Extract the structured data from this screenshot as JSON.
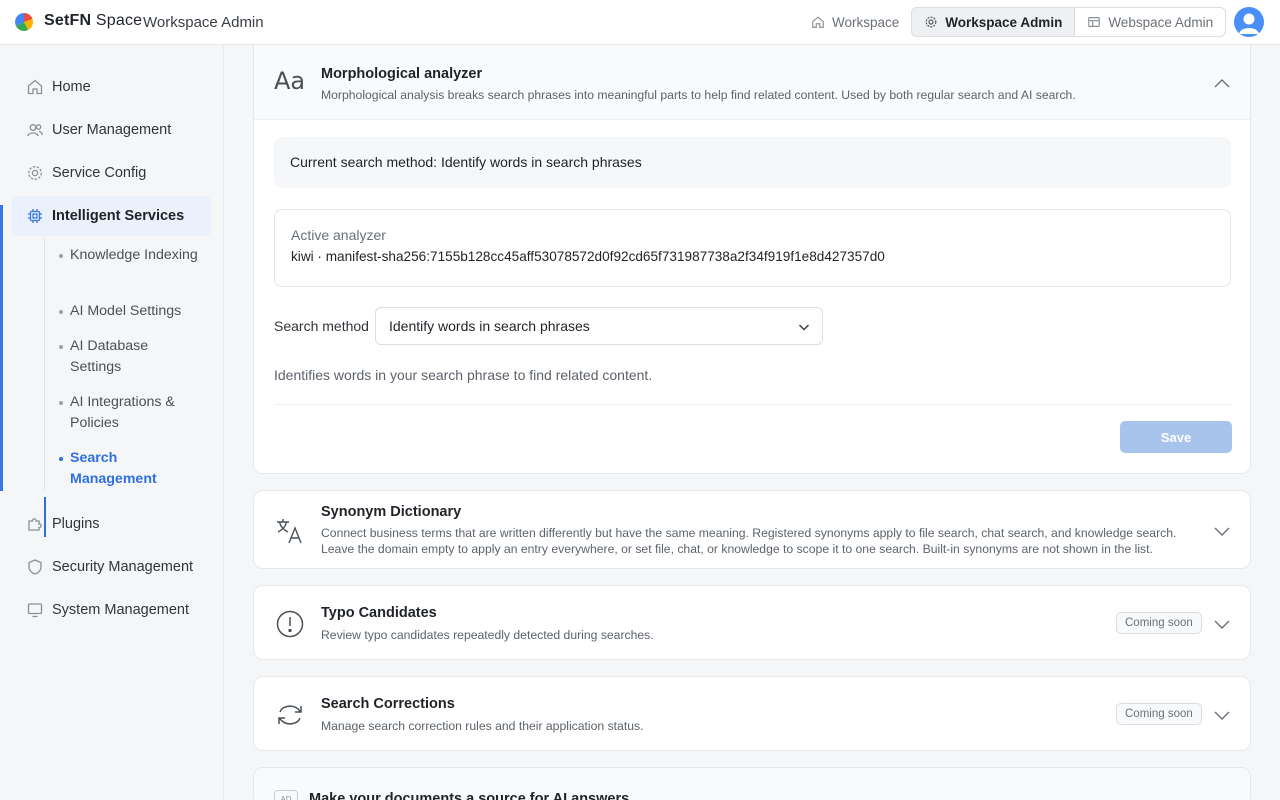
{
  "header": {
    "brand_bold": "SetFN",
    "brand_light": "Space",
    "subtitle": "Workspace Admin",
    "tabs": [
      {
        "label": "Workspace",
        "icon": "home-icon"
      },
      {
        "label": "Workspace Admin",
        "icon": "gear-icon"
      },
      {
        "label": "Webspace Admin",
        "icon": "layout-icon"
      }
    ]
  },
  "sidebar": {
    "items": [
      {
        "label": "Home",
        "icon": "home-icon"
      },
      {
        "label": "User Management",
        "icon": "users-icon"
      },
      {
        "label": "Service Config",
        "icon": "gear-icon"
      },
      {
        "label": "Intelligent Services",
        "icon": "chip-icon"
      },
      {
        "label": "Plugins",
        "icon": "puzzle-icon"
      },
      {
        "label": "Security Management",
        "icon": "shield-icon"
      },
      {
        "label": "System Management",
        "icon": "monitor-icon"
      }
    ],
    "sub_items": [
      {
        "label": "Knowledge Indexing"
      },
      {
        "label": "AI Model Settings"
      },
      {
        "label": "AI Database Settings"
      },
      {
        "label": "AI Integrations & Policies"
      },
      {
        "label": "Search Management"
      }
    ]
  },
  "main": {
    "morph": {
      "icon_text": "Aa",
      "title": "Morphological analyzer",
      "desc": "Morphological analysis breaks search phrases into meaningful parts to help find related content. Used by both regular search and AI search.",
      "current_method": "Current search method: Identify words in search phrases",
      "active_label": "Active analyzer",
      "active_value": "kiwi · manifest-sha256:7155b128cc45aff53078572d0f92cd65f731987738a2f34f919f1e8d427357d0",
      "method_label": "Search method",
      "method_value": "Identify words in search phrases",
      "method_help": "Identifies words in your search phrase to find related content.",
      "save_label": "Save"
    },
    "synonym": {
      "title": "Synonym Dictionary",
      "desc": "Connect business terms that are written differently but have the same meaning. Registered synonyms apply to file search, chat search, and knowledge search. Leave the domain empty to apply an entry everywhere, or set file, chat, or knowledge to scope it to one search. Built-in synonyms are not shown in the list."
    },
    "typo": {
      "title": "Typo Candidates",
      "desc": "Review typo candidates repeatedly detected during searches.",
      "badge": "Coming soon"
    },
    "corrections": {
      "title": "Search Corrections",
      "desc": "Manage search correction rules and their application status.",
      "badge": "Coming soon"
    },
    "docs": {
      "icon_text": "AD",
      "title": "Make your documents a source for AI answers"
    }
  },
  "colors": {
    "accent": "#2f6fde",
    "save_disabled": "#a8c4ec"
  }
}
